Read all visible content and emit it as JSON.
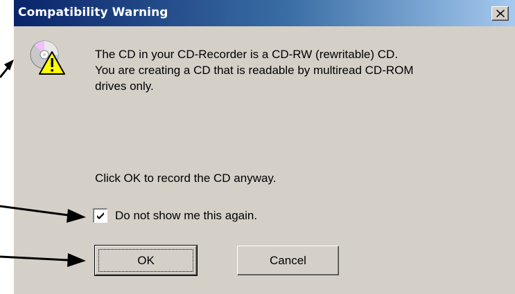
{
  "dialog": {
    "title": "Compatibility Warning",
    "message": "The CD in your CD-Recorder is a CD-RW (rewritable) CD.\n You are creating a CD that is readable by multiread CD-ROM\ndrives only.",
    "prompt": "Click OK to record the CD anyway.",
    "checkbox": {
      "label": "Do not show me this again.",
      "checked": true
    },
    "buttons": {
      "ok": "OK",
      "cancel": "Cancel"
    },
    "icons": {
      "close": "close-icon",
      "warning": "cd-warning-icon"
    }
  },
  "colors": {
    "titlebar_start": "#0a246a",
    "titlebar_end": "#a6caf0",
    "dialog_bg": "#d4d0c8",
    "warning_yellow": "#ffff00"
  }
}
